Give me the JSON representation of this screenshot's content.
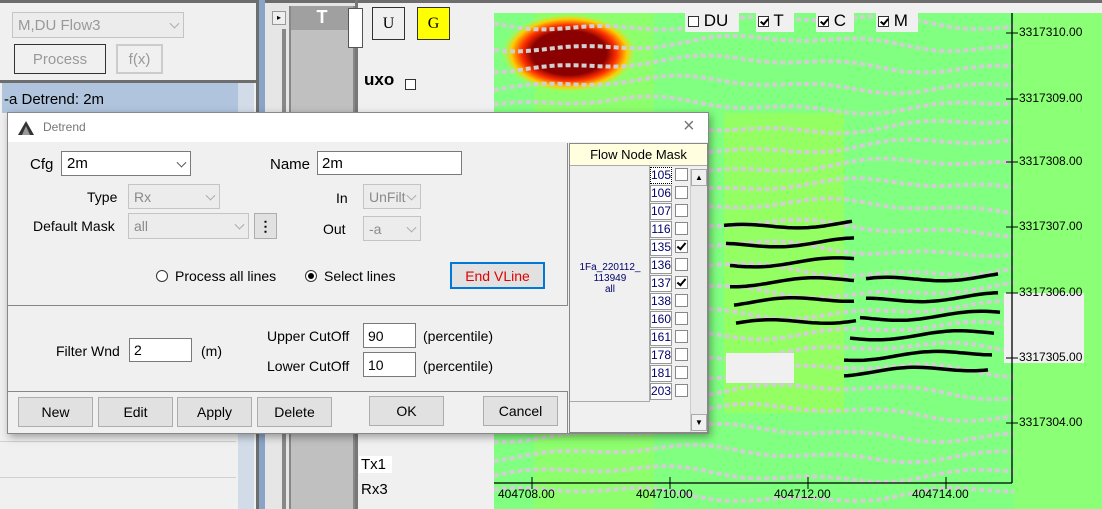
{
  "left_panel": {
    "flow_select": "M,DU Flow3",
    "process_label": "Process",
    "fx_label": "f(x)",
    "list_item": "-a Detrend: 2m"
  },
  "middle": {
    "column_header": "T"
  },
  "view_panel": {
    "u_label": "U",
    "g_label": "G",
    "uxo_label": "uxo",
    "uxo_checked": false,
    "tx_label": "Tx1",
    "rx_label": "Rx3",
    "g_color": "#ffff00"
  },
  "map": {
    "toggles": [
      {
        "label": "DU",
        "checked": false
      },
      {
        "label": "T",
        "checked": true
      },
      {
        "label": "C",
        "checked": true
      },
      {
        "label": "M",
        "checked": true
      }
    ],
    "y_ticks": [
      "3317310.00",
      "3317309.00",
      "3317308.00",
      "3317307.00",
      "3317306.00",
      "3317305.00",
      "3317304.00"
    ],
    "x_ticks": [
      "404708.00",
      "404710.00",
      "404712.00",
      "404714.00"
    ],
    "background_color": "#80ff80",
    "hotspot_color": "#8b0000"
  },
  "dialog": {
    "title": "Detrend",
    "close_label": "×",
    "cfg_label": "Cfg",
    "cfg_value": "2m",
    "name_label": "Name",
    "name_value": "2m",
    "type_label": "Type",
    "type_value": "Rx",
    "in_label": "In",
    "in_value": "UnFilt",
    "default_mask_label": "Default Mask",
    "default_mask_value": "all",
    "more_label": "⋮",
    "out_label": "Out",
    "out_value": "-a",
    "radio_all_label": "Process all lines",
    "radio_select_label": "Select lines",
    "radio_selected": "select",
    "end_vline_label": "End VLine",
    "filter_wnd_label": "Filter Wnd",
    "filter_wnd_value": "2",
    "filter_wnd_unit": "(m)",
    "upper_cutoff_label": "Upper CutOff",
    "upper_cutoff_value": "90",
    "upper_cutoff_unit": "(percentile)",
    "lower_cutoff_label": "Lower CutOff",
    "lower_cutoff_value": "10",
    "lower_cutoff_unit": "(percentile)",
    "buttons": {
      "new": "New",
      "edit": "Edit",
      "apply": "Apply",
      "delete": "Delete",
      "ok": "OK",
      "cancel": "Cancel"
    },
    "mask": {
      "header": "Flow Node Mask",
      "group_label": "1Fa_220112_\n113949\nall",
      "nodes": [
        {
          "id": "105",
          "checked": false
        },
        {
          "id": "106",
          "checked": false
        },
        {
          "id": "107",
          "checked": false
        },
        {
          "id": "116",
          "checked": false
        },
        {
          "id": "135",
          "checked": true
        },
        {
          "id": "136",
          "checked": false
        },
        {
          "id": "137",
          "checked": true
        },
        {
          "id": "138",
          "checked": false
        },
        {
          "id": "160",
          "checked": false
        },
        {
          "id": "161",
          "checked": false
        },
        {
          "id": "178",
          "checked": false
        },
        {
          "id": "181",
          "checked": false
        },
        {
          "id": "203",
          "checked": false
        }
      ]
    }
  }
}
